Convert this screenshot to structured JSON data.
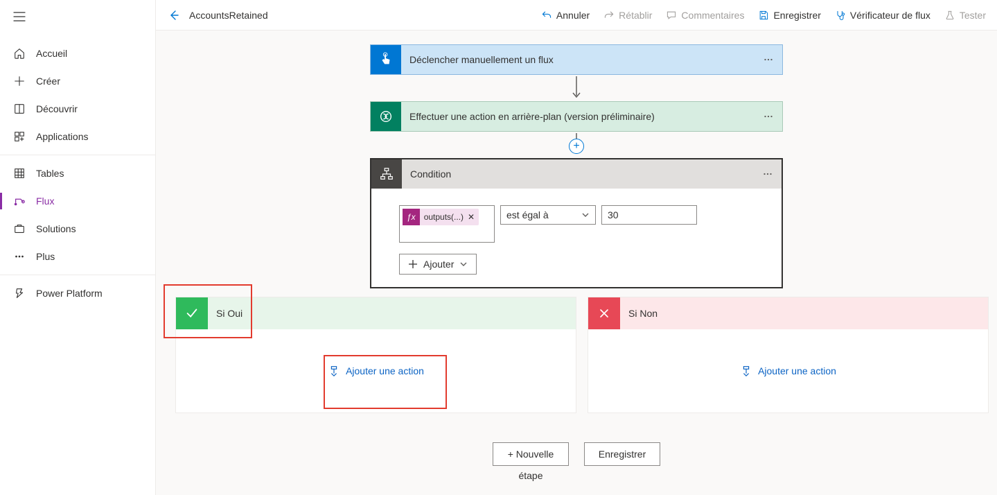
{
  "header": {
    "flow_name": "AccountsRetained",
    "actions": {
      "undo": "Annuler",
      "redo": "Rétablir",
      "comments": "Commentaires",
      "save": "Enregistrer",
      "checker": "Vérificateur de flux",
      "test": "Tester"
    }
  },
  "sidebar": {
    "home": "Accueil",
    "create": "Créer",
    "discover": "Découvrir",
    "apps": "Applications",
    "tables": "Tables",
    "flows": "Flux",
    "solutions": "Solutions",
    "more": "Plus",
    "platform": "Power Platform"
  },
  "cards": {
    "trigger": "Déclencher manuellement un flux",
    "unbound": "Effectuer une action en arrière-plan (version préliminaire)",
    "condition": "Condition"
  },
  "condition": {
    "expr_label": "outputs(...)",
    "operator": "est égal à",
    "value": "30",
    "add": "Ajouter"
  },
  "branches": {
    "yes": "Si Oui",
    "no": "Si Non",
    "add_action": "Ajouter une action"
  },
  "footer": {
    "new_step": "+ Nouvelle",
    "step_word": "étape",
    "save": "Enregistrer"
  }
}
